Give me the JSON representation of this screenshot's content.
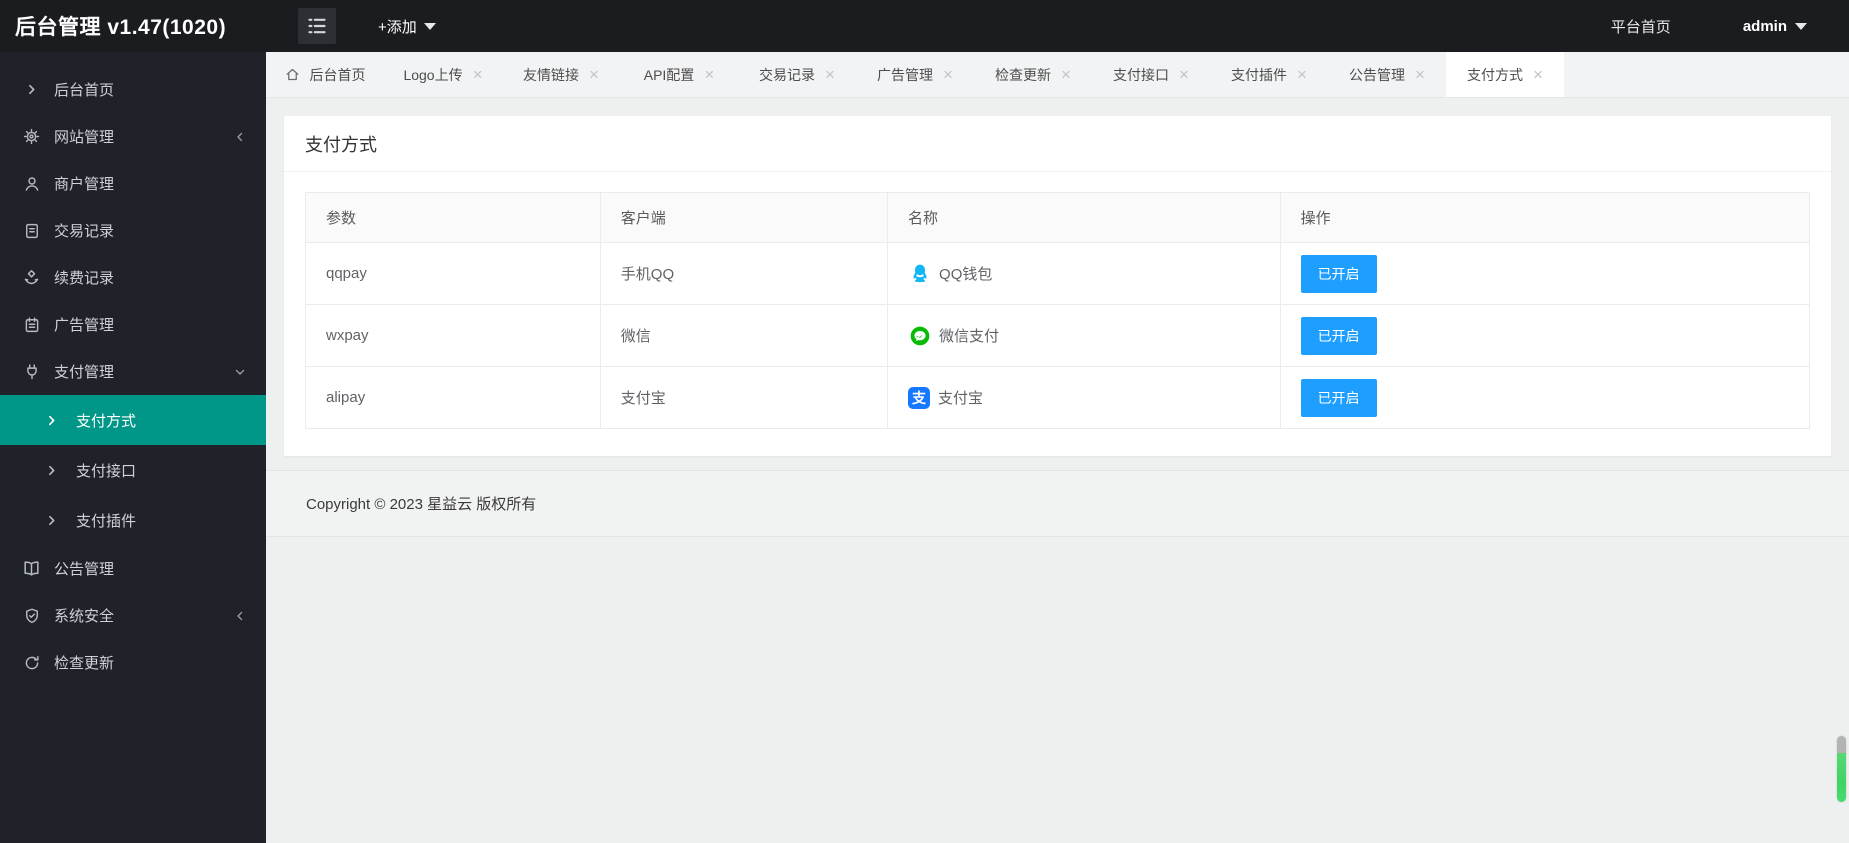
{
  "header": {
    "app_title": "后台管理 v1.47(1020)",
    "add_button_label": "+添加",
    "platform_home_label": "平台首页",
    "username": "admin"
  },
  "sidebar": {
    "items": [
      {
        "label": "后台首页",
        "icon": "chevron-right-icon"
      },
      {
        "label": "网站管理",
        "icon": "gear-icon",
        "state": "collapsed"
      },
      {
        "label": "商户管理",
        "icon": "user-icon"
      },
      {
        "label": "交易记录",
        "icon": "document-icon"
      },
      {
        "label": "续费记录",
        "icon": "renewal-hands-icon"
      },
      {
        "label": "广告管理",
        "icon": "clipboard-icon"
      },
      {
        "label": "支付管理",
        "icon": "plug-icon",
        "state": "expanded"
      },
      {
        "label": "支付方式",
        "type": "sub",
        "active": true
      },
      {
        "label": "支付接口",
        "type": "sub"
      },
      {
        "label": "支付插件",
        "type": "sub"
      },
      {
        "label": "公告管理",
        "icon": "book-icon"
      },
      {
        "label": "系统安全",
        "icon": "shield-icon",
        "state": "collapsed"
      },
      {
        "label": "检查更新",
        "icon": "refresh-icon"
      }
    ]
  },
  "tabs": [
    {
      "label": "后台首页",
      "closable": false,
      "active": false
    },
    {
      "label": "Logo上传",
      "closable": true,
      "active": false
    },
    {
      "label": "友情链接",
      "closable": true,
      "active": false
    },
    {
      "label": "API配置",
      "closable": true,
      "active": false
    },
    {
      "label": "交易记录",
      "closable": true,
      "active": false
    },
    {
      "label": "广告管理",
      "closable": true,
      "active": false
    },
    {
      "label": "检查更新",
      "closable": true,
      "active": false
    },
    {
      "label": "支付接口",
      "closable": true,
      "active": false
    },
    {
      "label": "支付插件",
      "closable": true,
      "active": false
    },
    {
      "label": "公告管理",
      "closable": true,
      "active": false
    },
    {
      "label": "支付方式",
      "closable": true,
      "active": true
    }
  ],
  "page": {
    "title": "支付方式",
    "table": {
      "columns": [
        "参数",
        "客户端",
        "名称",
        "操作"
      ],
      "rows": [
        {
          "param": "qqpay",
          "client": "手机QQ",
          "name": "QQ钱包",
          "icon": "qq-wallet-icon",
          "action_label": "已开启"
        },
        {
          "param": "wxpay",
          "client": "微信",
          "name": "微信支付",
          "icon": "wechat-pay-icon",
          "action_label": "已开启"
        },
        {
          "param": "alipay",
          "client": "支付宝",
          "name": "支付宝",
          "icon": "alipay-icon",
          "action_label": "已开启"
        }
      ]
    }
  },
  "footer": {
    "copyright": "Copyright © 2023 星益云 版权所有"
  },
  "icons": {
    "close_glyph": "×",
    "alipay_glyph": "支"
  },
  "colors": {
    "accent_green": "#009688",
    "button_blue": "#1E9FFF",
    "qq_blue": "#12B7F5",
    "wechat_green": "#09BB07",
    "alipay_blue": "#1677FF"
  }
}
